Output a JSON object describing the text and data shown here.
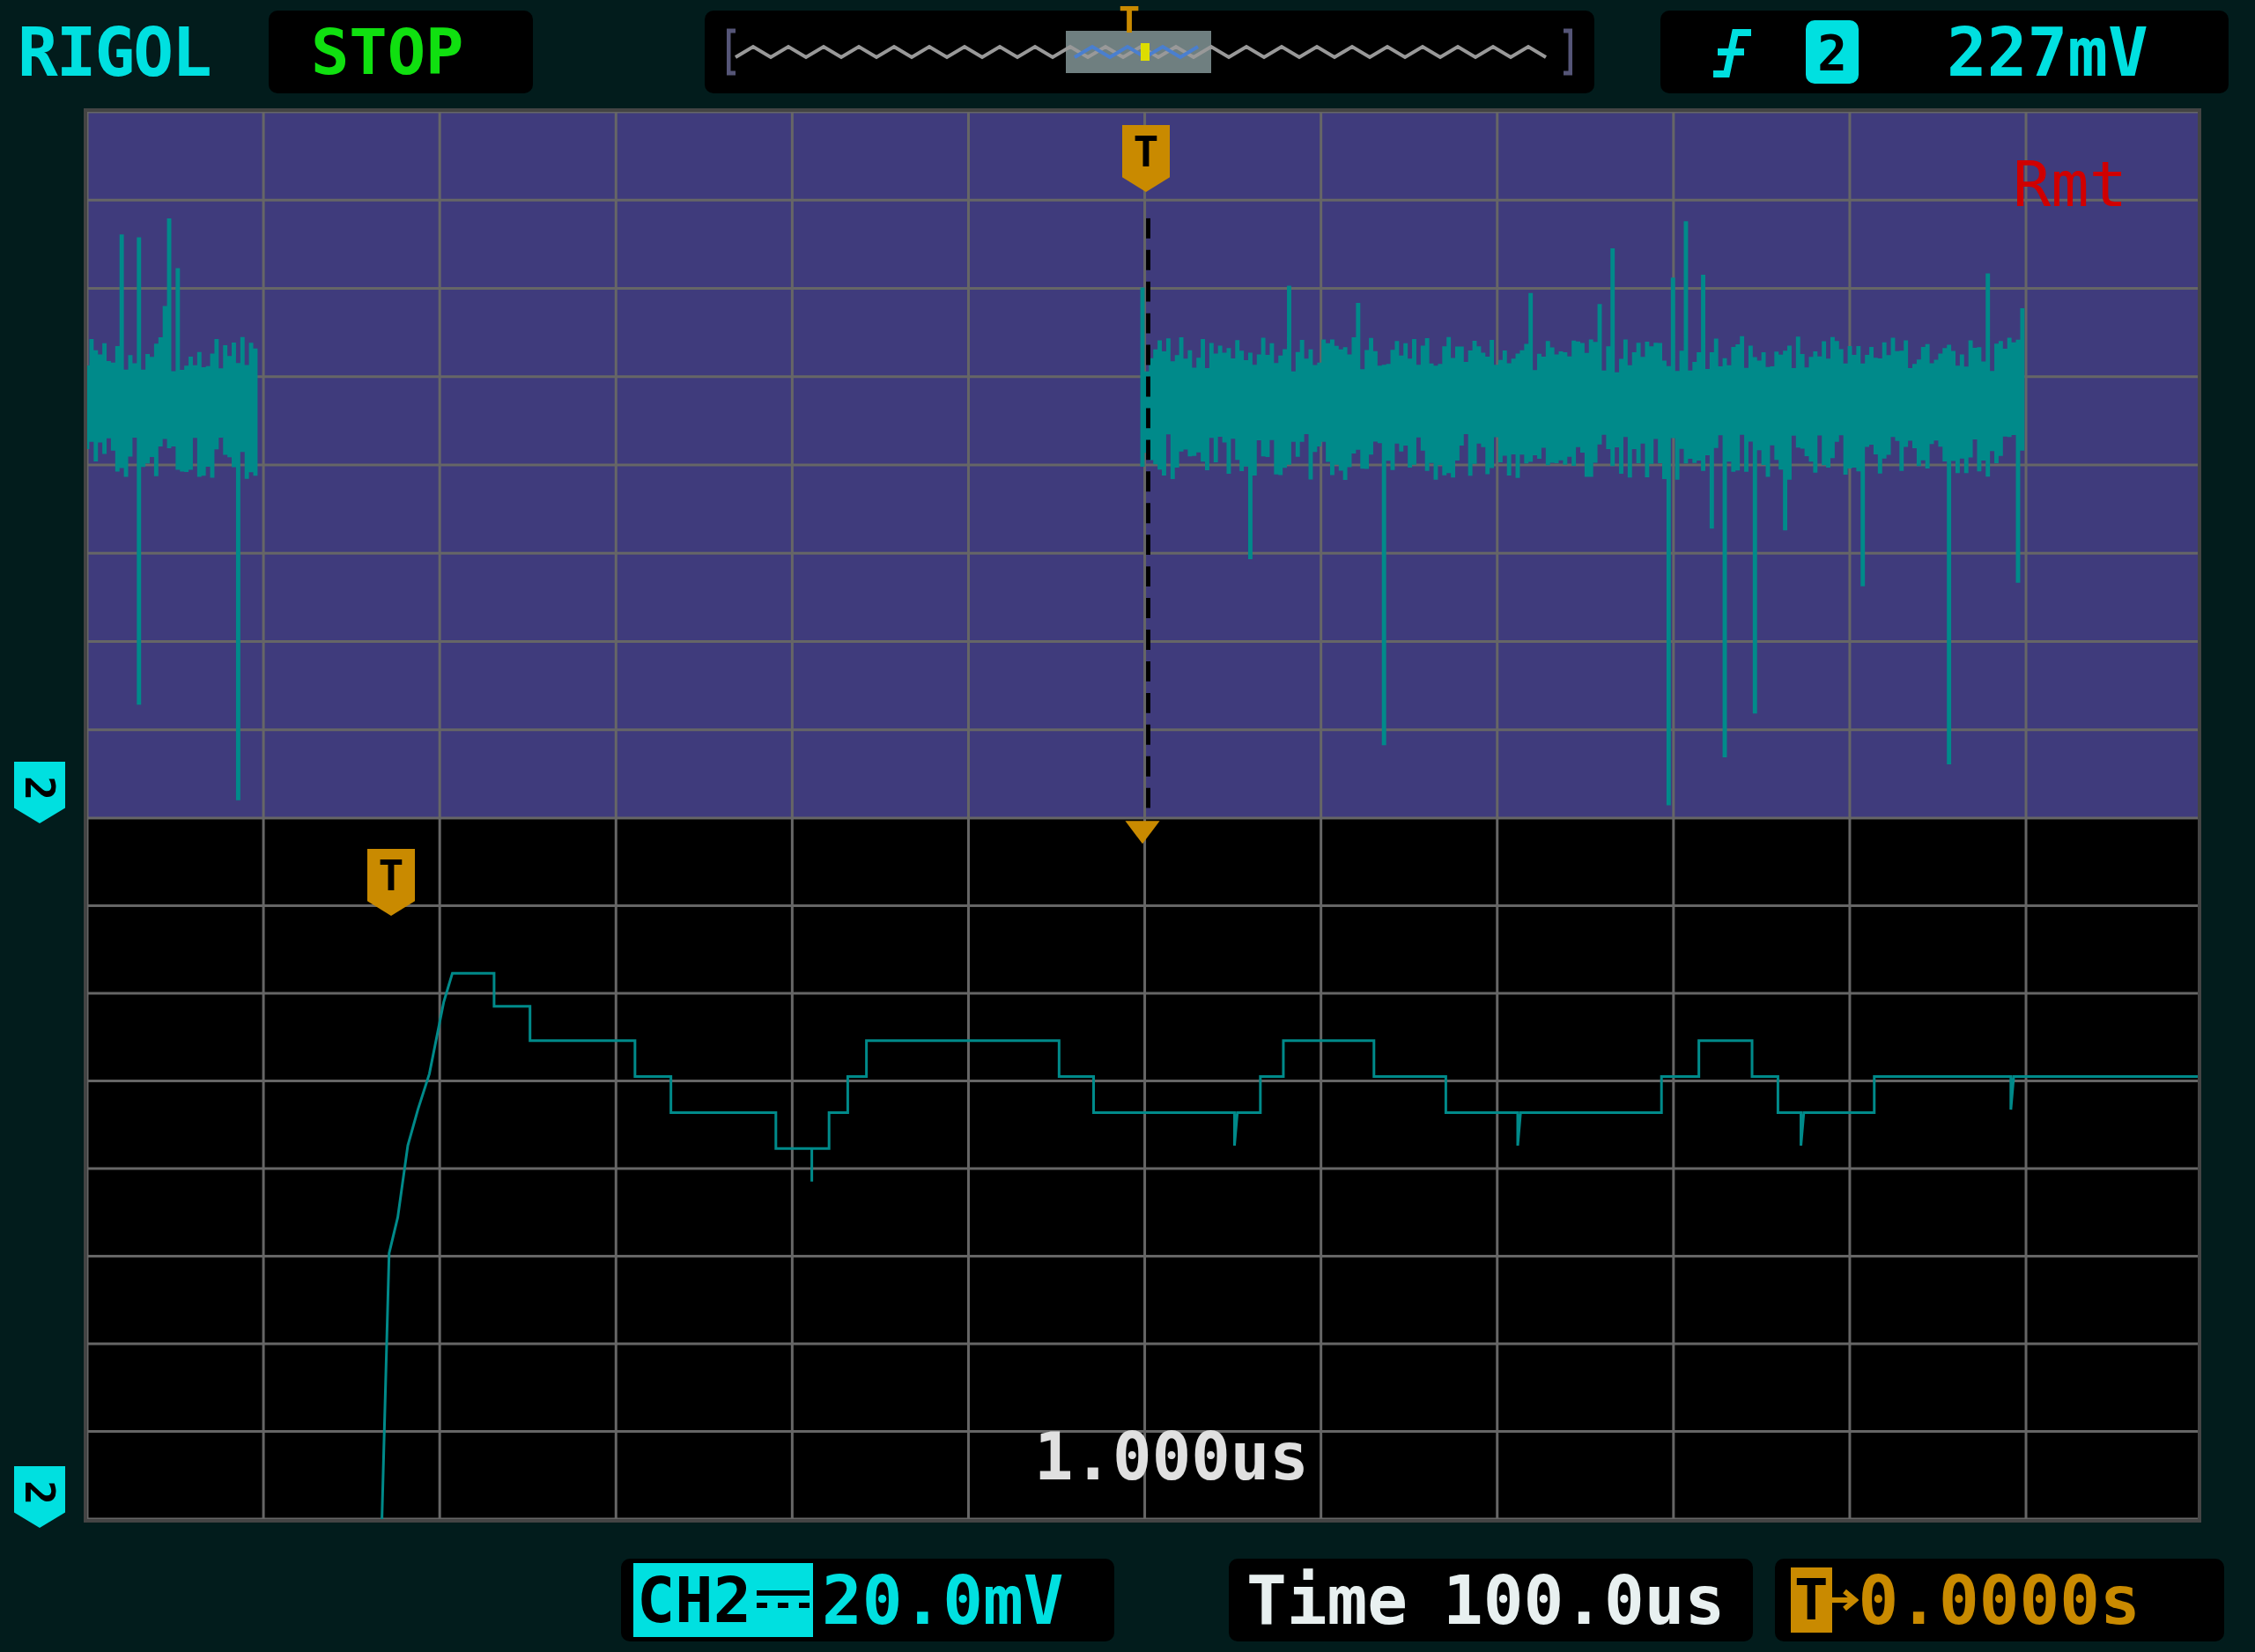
{
  "header": {
    "brand": "RIGOL",
    "run_state": "STOP",
    "timeline_marker": "T",
    "trigger": {
      "channel": "2",
      "level": "227mV"
    }
  },
  "display": {
    "remote_label": "Rmt",
    "top_trigger_marker": "T",
    "bottom_trigger_marker": "T",
    "time_label": "1.000us",
    "channel_markers": [
      "2",
      "2"
    ]
  },
  "footer": {
    "channel": {
      "name": "CH2",
      "scale": "20.0mV"
    },
    "timebase": {
      "label": "Time",
      "value": "100.0us"
    },
    "trigger_offset": {
      "marker": "T",
      "value": "0.0000s"
    }
  }
}
